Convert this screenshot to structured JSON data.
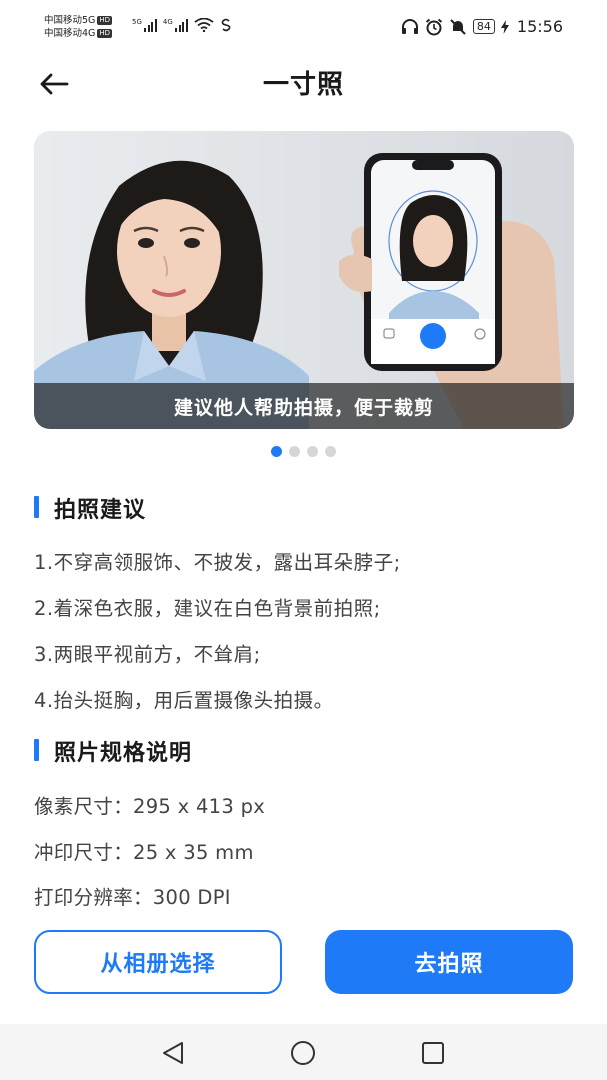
{
  "status_bar": {
    "carrier1": "中国移动5G",
    "carrier2": "中国移动4G",
    "hd_badge": "HD",
    "sig1_label": "5G",
    "sig2_label": "4G",
    "battery": "84",
    "time": "15:56"
  },
  "header": {
    "title": "一寸照"
  },
  "banner": {
    "caption": "建议他人帮助拍摄，便于裁剪",
    "slide_count": 4,
    "active_slide": 1
  },
  "tips": {
    "title": "拍照建议",
    "items": [
      "1.不穿高领服饰、不披发，露出耳朵脖子;",
      "2.着深色衣服，建议在白色背景前拍照;",
      "3.两眼平视前方，不耸肩;",
      "4.抬头挺胸，用后置摄像头拍摄。"
    ]
  },
  "specs": {
    "title": "照片规格说明",
    "pixel_size": "像素尺寸：295 x 413 px",
    "print_size": "冲印尺寸：25 x 35 mm",
    "resolution": "打印分辨率：300 DPI"
  },
  "actions": {
    "album_label": "从相册选择",
    "shoot_label": "去拍照"
  },
  "colors": {
    "accent": "#1f7af7"
  }
}
